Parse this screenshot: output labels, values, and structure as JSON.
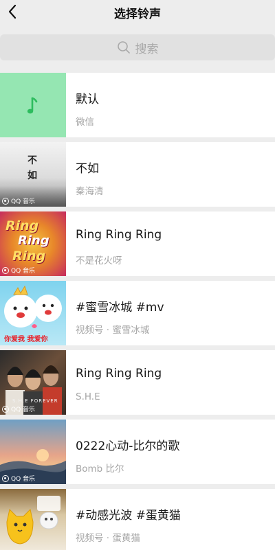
{
  "header": {
    "title": "选择铃声",
    "back_icon": "chevron-left-icon"
  },
  "search": {
    "placeholder": "搜索",
    "icon": "search-icon"
  },
  "ringtones": [
    {
      "title": "默认",
      "subtitle": "微信",
      "thumb_style": "default-green",
      "thumb_icon": "music-note-icon"
    },
    {
      "title": "不如",
      "subtitle": "秦海清",
      "thumb_style": "album-buru",
      "cover_text": [
        "不",
        "如"
      ],
      "badge": "QQ 音乐"
    },
    {
      "title": "Ring Ring Ring",
      "subtitle": "不是花火呀",
      "thumb_style": "album-ringring-1",
      "cover_text": [
        "Ring",
        "Ring",
        "Ring"
      ],
      "badge": "QQ 音乐"
    },
    {
      "title": "#蜜雪冰城 #mv",
      "subtitle": "视频号 · 蜜雪冰城",
      "thumb_style": "video-mixue",
      "cover_text": [
        "你爱我",
        "我爱你"
      ]
    },
    {
      "title": "Ring Ring Ring",
      "subtitle": "S.H.E",
      "thumb_style": "album-she",
      "cover_text": [
        "S.H.E FOREVER"
      ],
      "badge": "QQ 音乐"
    },
    {
      "title": "0222心动-比尔的歌",
      "subtitle": "Bomb 比尔",
      "thumb_style": "album-sunset",
      "badge": "QQ 音乐"
    },
    {
      "title": "#动感光波 #蛋黄猫",
      "subtitle": "视频号 · 蛋黄猫",
      "thumb_style": "video-cat"
    }
  ],
  "colors": {
    "background": "#ededed",
    "default_thumb": "#95e6b2",
    "music_note": "#2dbc5e"
  }
}
